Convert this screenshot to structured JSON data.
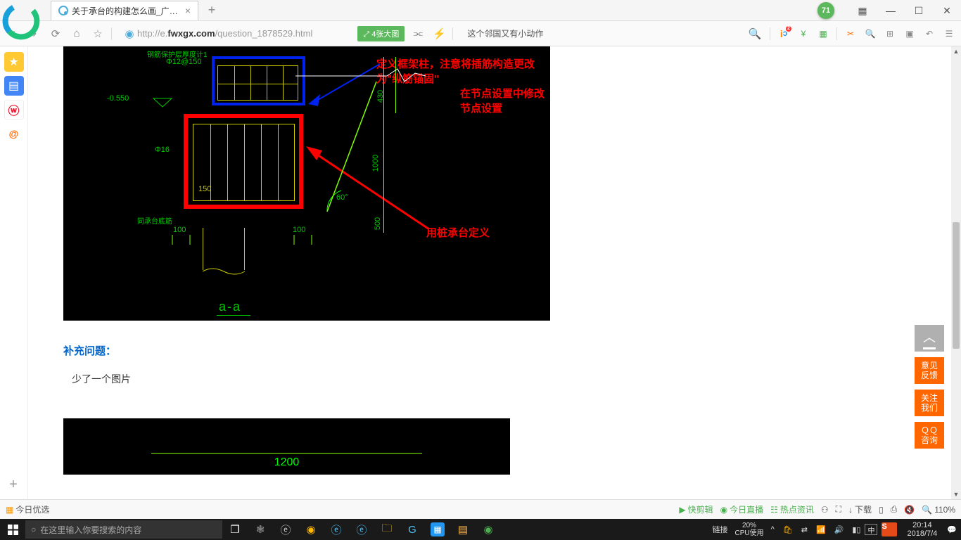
{
  "tab": {
    "title": "关于承台的构建怎么画_广联达服",
    "close": "×"
  },
  "titlebar": {
    "badge": "71"
  },
  "win": {
    "grid": "▦",
    "min": "—",
    "max": "☐",
    "close": "✕"
  },
  "toolbar": {
    "url_prefix": "http://e.",
    "url_domain": "fwxgx.com",
    "url_path": "/question_1878529.html",
    "green_btn": "⤢ 4张大图",
    "promo": "这个邻国又有小动作"
  },
  "content": {
    "cad": {
      "ann1": "定义框架柱，注意将插筋构造更改为\"纵筋锚固\"",
      "ann2": "在节点设置中修改节点设置",
      "ann3": "用桩承台定义",
      "dim_elev": "-0.550",
      "dim_hatch1": "钢筋保护层厚度计1",
      "dim_spacing": "Φ12@150",
      "dim_d16": "Φ16",
      "dim_150": "150",
      "dim_430": "430",
      "dim_1000": "1000",
      "dim_500": "500",
      "dim_60": "60°",
      "dim_100a": "100",
      "dim_100b": "100",
      "note_same": "同承台底筋",
      "section": "a-a"
    },
    "qa_title": "补充问题：",
    "qa_body": "少了一个图片",
    "cad2_dim": "1200"
  },
  "right_float": {
    "top_arrow": "⌃",
    "feedback": "意见\n反馈",
    "follow": "关注\n我们",
    "qq": "ＱＱ\n咨询"
  },
  "bottombar": {
    "today": "今日优选",
    "kuai": "快剪辑",
    "live": "今日直播",
    "hot": "热点资讯",
    "download": "下载",
    "zoom": "110%"
  },
  "taskbar": {
    "search_placeholder": "在这里输入你要搜索的内容",
    "link": "链接",
    "cpu_pct": "20%",
    "cpu_label": "CPU使用",
    "ime_cn": "中",
    "ime_s": "S",
    "time": "20:14",
    "date": "2018/7/4"
  }
}
